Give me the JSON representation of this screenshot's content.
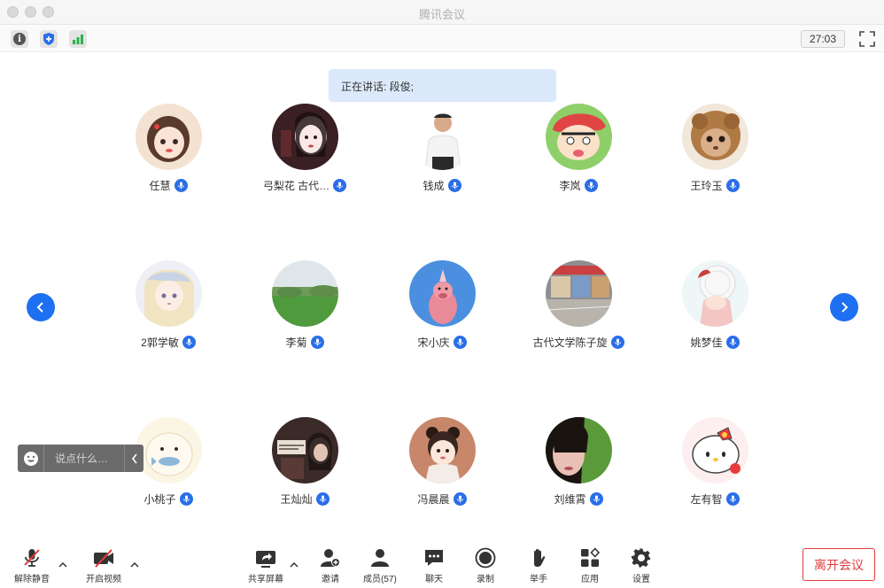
{
  "window": {
    "title": "腾讯会议"
  },
  "toolbar": {
    "timer": "27:03"
  },
  "speaking": {
    "label": "正在讲话: 段俊;"
  },
  "participants": [
    {
      "name": "任慧"
    },
    {
      "name": "弓梨花  古代…"
    },
    {
      "name": "钱成"
    },
    {
      "name": "李岚"
    },
    {
      "name": "王玲玉"
    },
    {
      "name": "2郭学敏"
    },
    {
      "name": "李菊"
    },
    {
      "name": "宋小庆"
    },
    {
      "name": "古代文学陈子旋"
    },
    {
      "name": "姚梦佳"
    },
    {
      "name": "小桃子"
    },
    {
      "name": "王灿灿"
    },
    {
      "name": "冯晨晨"
    },
    {
      "name": "刘维霄"
    },
    {
      "name": "左有智"
    }
  ],
  "chat": {
    "placeholder": "说点什么…"
  },
  "controls": {
    "unmute": "解除静音",
    "video": "开启视频",
    "share": "共享屏幕",
    "invite": "邀请",
    "members": "成员(57)",
    "chat": "聊天",
    "record": "录制",
    "raise_hand": "举手",
    "apps": "应用",
    "settings": "设置",
    "leave": "离开会议"
  },
  "colors": {
    "accent": "#1e6ff1",
    "leave": "#e23b3b",
    "banner": "#dbe9fb"
  }
}
